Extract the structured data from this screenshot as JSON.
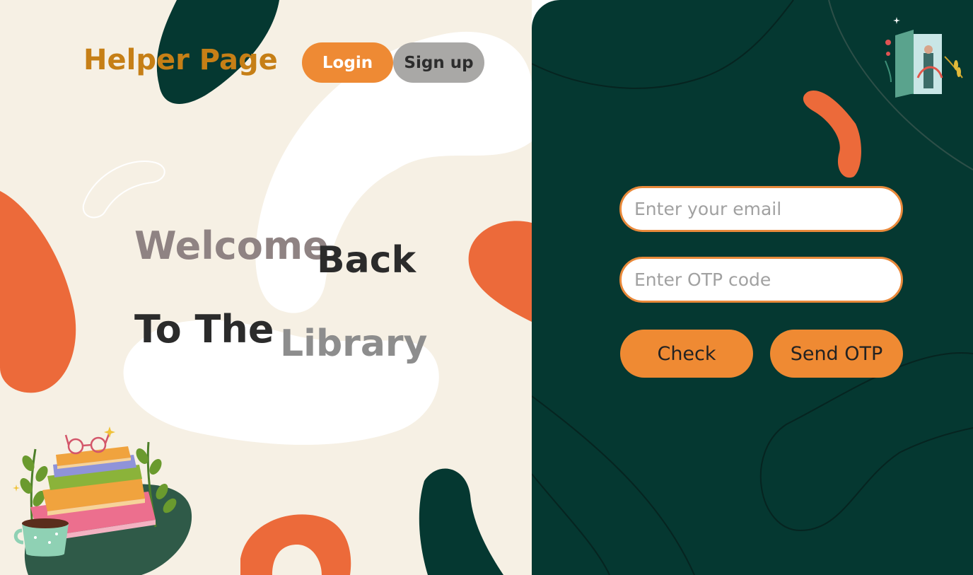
{
  "header": {
    "brand": "Helper Page",
    "login_label": "Login",
    "signup_label": "Sign up"
  },
  "hero": {
    "word1": "Welcome",
    "word2": "Back",
    "word3": "To The",
    "word4": "Library"
  },
  "form": {
    "email_placeholder": "Enter your email",
    "otp_placeholder": "Enter OTP code",
    "check_label": "Check",
    "send_otp_label": "Send OTP"
  },
  "colors": {
    "cream": "#f6f0e4",
    "dark_green": "#053831",
    "orange": "#ee8a34",
    "coral": "#ec6a3a",
    "brand": "#c67f16"
  },
  "icons": {
    "books": "stack-of-books-illustration",
    "door": "open-book-door-illustration"
  }
}
